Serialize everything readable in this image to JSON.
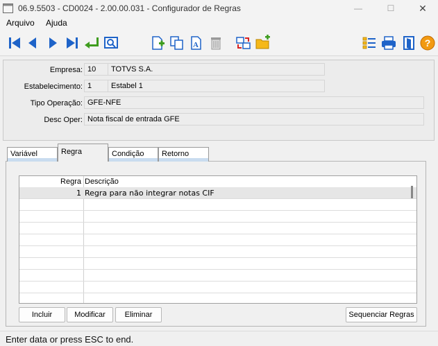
{
  "window": {
    "title": "06.9.5503 - CD0024 - 2.00.00.031 - Configurador de Regras",
    "minimize_glyph": "—",
    "maximize_glyph": "☐",
    "close_glyph": "✕"
  },
  "menu": {
    "items": [
      "Arquivo",
      "Ajuda"
    ]
  },
  "toolbar": {
    "icons": [
      "first-record-icon",
      "previous-record-icon",
      "next-record-icon",
      "last-record-icon",
      "goto-icon",
      "search-icon",
      "new-record-icon",
      "copy-record-icon",
      "edit-record-icon",
      "delete-record-icon",
      "refresh-icon",
      "new-folder-icon",
      "list-icon",
      "print-icon",
      "exit-icon",
      "help-icon"
    ],
    "help_glyph": "?"
  },
  "header": {
    "empresa": {
      "label": "Empresa:",
      "code": "10",
      "name": "TOTVS S.A."
    },
    "estabelecimento": {
      "label": "Estabelecimento:",
      "code": "1",
      "name": "Estabel 1"
    },
    "tipo_operacao": {
      "label": "Tipo Operação:",
      "value": "GFE-NFE"
    },
    "desc_oper": {
      "label": "Desc Oper:",
      "value": "Nota fiscal de entrada GFE"
    }
  },
  "tabs": [
    {
      "label": "Variável",
      "active": false
    },
    {
      "label": "Regra",
      "active": true
    },
    {
      "label": "Condição",
      "active": false
    },
    {
      "label": "Retorno",
      "active": false
    }
  ],
  "grid": {
    "columns": [
      "Regra",
      "Descrição"
    ],
    "rows": [
      {
        "regra": "1",
        "descricao": "Regra para não integrar notas CIF"
      }
    ]
  },
  "buttons": {
    "incluir": "Incluir",
    "modificar": "Modificar",
    "eliminar": "Eliminar",
    "sequenciar": "Sequenciar Regras"
  },
  "status": "Enter data or press ESC to end.",
  "colors": {
    "nav_blue": "#1e63c8",
    "enter_green": "#3e9c1e",
    "help_orange": "#f29a12",
    "tab_accent": "#c9dcef"
  }
}
